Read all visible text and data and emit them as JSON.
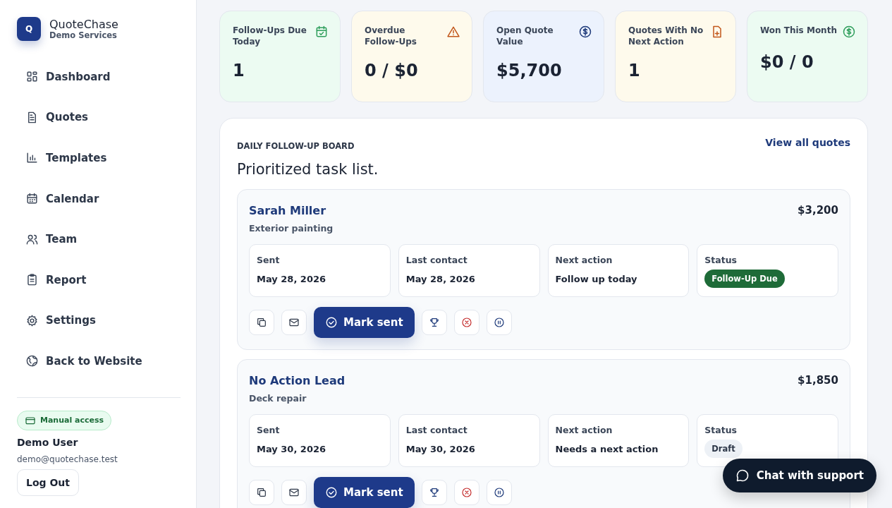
{
  "brand": {
    "logo": "Q",
    "name": "QuoteChase",
    "subtitle": "Demo Services"
  },
  "nav": [
    {
      "label": "Dashboard",
      "kind": "grid"
    },
    {
      "label": "Quotes",
      "kind": "doc"
    },
    {
      "label": "Templates",
      "kind": "chart"
    },
    {
      "label": "Calendar",
      "kind": "calendar"
    },
    {
      "label": "Team",
      "kind": "users"
    },
    {
      "label": "Report",
      "kind": "clipboard"
    },
    {
      "label": "Settings",
      "kind": "gear"
    },
    {
      "label": "Back to Website",
      "kind": "globe"
    }
  ],
  "account": {
    "badge": "Manual access",
    "name": "Demo User",
    "email": "demo@quotechase.test",
    "logout": "Log Out"
  },
  "stats": [
    {
      "label": "Follow-Ups Due Today",
      "value": "1",
      "kind": "calendar-check"
    },
    {
      "label": "Overdue Follow-Ups",
      "value": "0 / $0",
      "kind": "warning"
    },
    {
      "label": "Open Quote Value",
      "value": "$5,700",
      "kind": "dollar"
    },
    {
      "label": "Quotes With No Next Action",
      "value": "1",
      "kind": "file-plus"
    },
    {
      "label": "Won This Month",
      "value": "$0 / 0",
      "kind": "dollar-green"
    }
  ],
  "board": {
    "eyebrow": "DAILY FOLLOW-UP BOARD",
    "title": "Prioritized task list.",
    "link": "View all quotes",
    "tasks": [
      {
        "name": "Sarah Miller",
        "service": "Exterior painting",
        "amount": "$3,200",
        "fields": [
          {
            "label": "Sent",
            "value": "May 28, 2026"
          },
          {
            "label": "Last contact",
            "value": "May 28, 2026"
          },
          {
            "label": "Next action",
            "value": "Follow up today"
          }
        ],
        "status_label": "Status",
        "status": {
          "text": "Follow-Up Due",
          "kind": "due"
        },
        "primary": "Mark sent"
      },
      {
        "name": "No Action Lead",
        "service": "Deck repair",
        "amount": "$1,850",
        "fields": [
          {
            "label": "Sent",
            "value": "May 30, 2026"
          },
          {
            "label": "Last contact",
            "value": "May 30, 2026"
          },
          {
            "label": "Next action",
            "value": "Needs a next action"
          }
        ],
        "status_label": "Status",
        "status": {
          "text": "Draft",
          "kind": "draft"
        },
        "primary": "Mark sent"
      }
    ]
  },
  "chat": {
    "label": "Chat with support"
  }
}
